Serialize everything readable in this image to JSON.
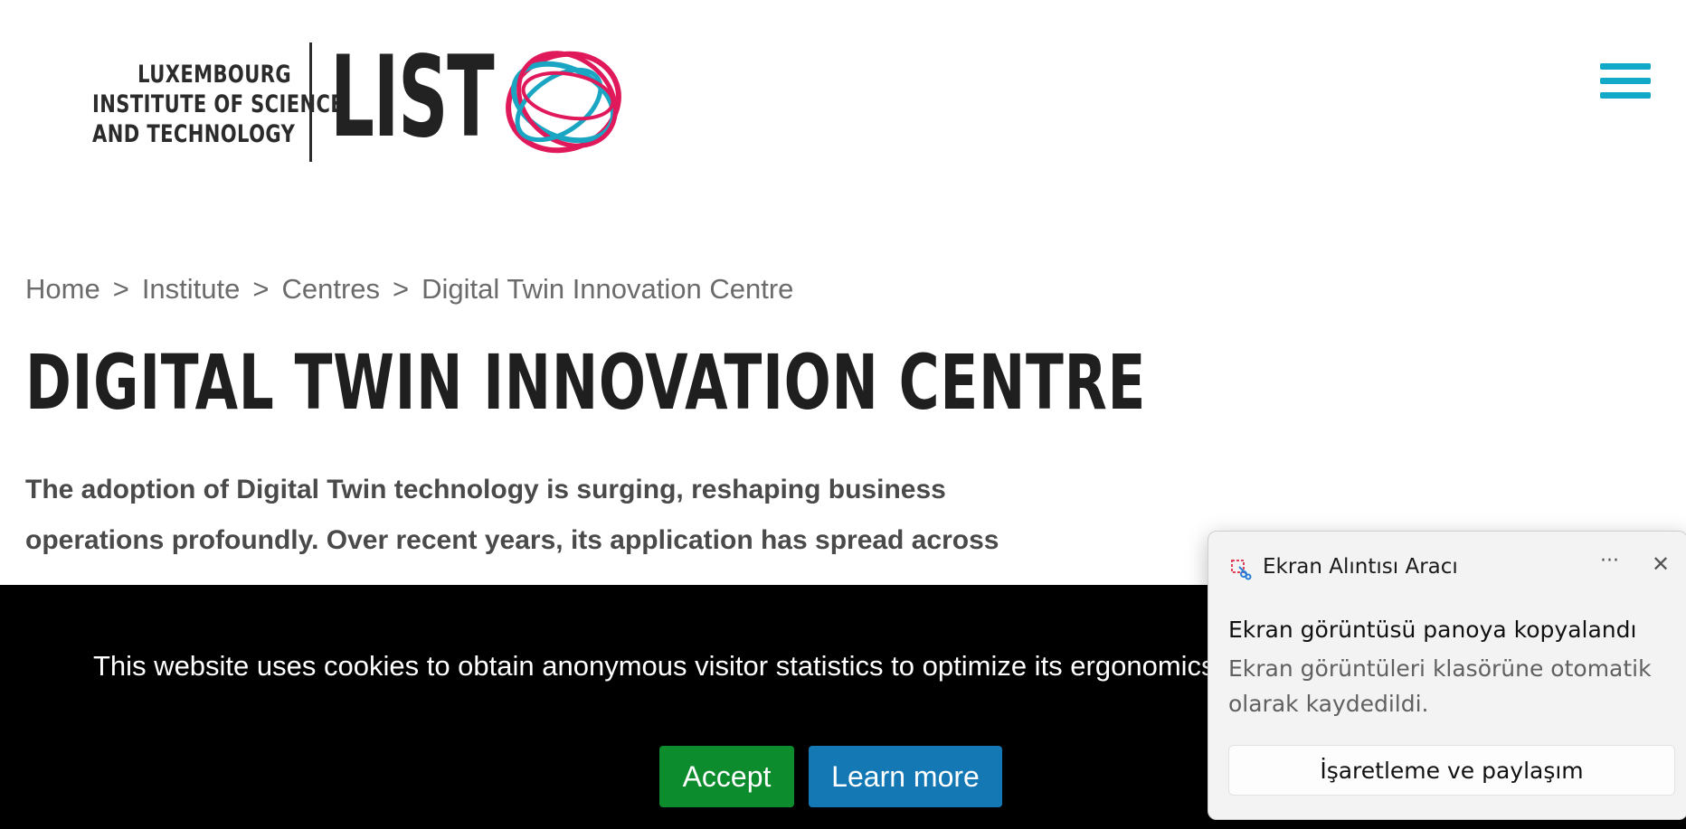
{
  "header": {
    "logo_lines": [
      "LUXEMBOURG",
      "INSTITUTE OF SCIENCE",
      "AND TECHNOLOGY"
    ],
    "logo_wordmark": "LIST",
    "menu_icon": "hamburger-menu-icon",
    "accent_color": "#11a9c7"
  },
  "breadcrumb": {
    "items": [
      "Home",
      "Institute",
      "Centres",
      "Digital Twin Innovation Centre"
    ],
    "separator": ">"
  },
  "page": {
    "title": "DIGITAL TWIN INNOVATION CENTRE",
    "intro_line1": "The adoption of Digital Twin technology is surging, reshaping business",
    "intro_line2": "operations profoundly. Over recent years, its application has spread across"
  },
  "cookie_banner": {
    "text": "This website uses cookies to obtain anonymous visitor statistics to optimize its ergonomics.",
    "accept_label": "Accept",
    "learn_more_label": "Learn more",
    "accept_color": "#0c8c2c",
    "learn_more_color": "#1478b4"
  },
  "toast": {
    "app_name": "Ekran Alıntısı Aracı",
    "more_label": "···",
    "close_label": "✕",
    "heading": "Ekran görüntüsü panoya kopyalandı",
    "body": "Ekran görüntüleri klasörüne otomatik olarak kaydedildi.",
    "action_label": "İşaretleme ve paylaşım"
  }
}
